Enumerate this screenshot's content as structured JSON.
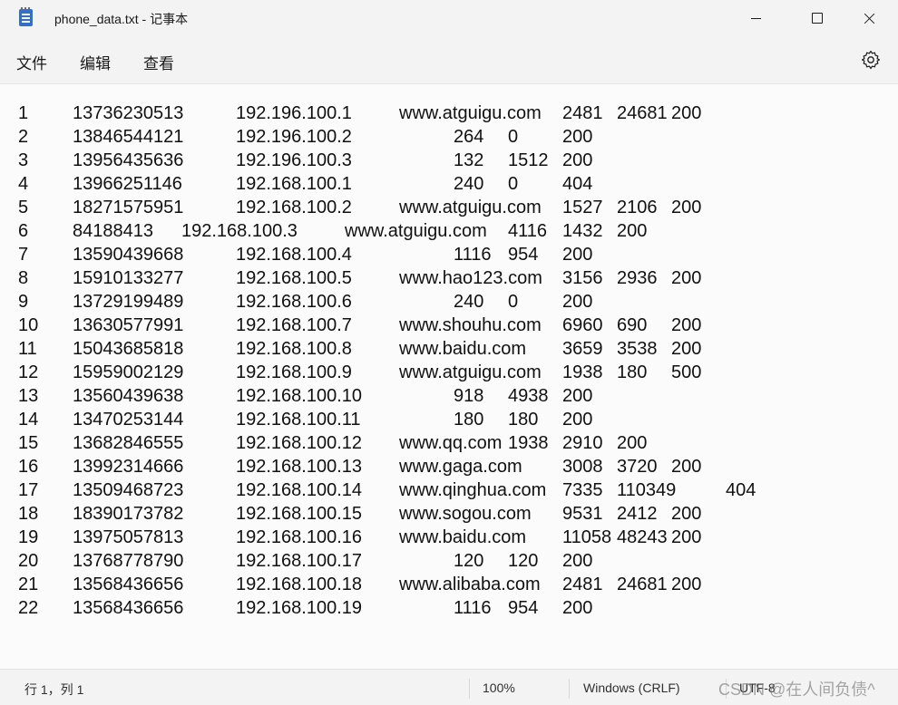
{
  "window": {
    "title": "phone_data.txt - 记事本"
  },
  "menu": {
    "file": "文件",
    "edit": "编辑",
    "view": "查看"
  },
  "icons": {
    "app": "notepad-icon",
    "settings": "gear-icon",
    "minimize": "minimize-icon",
    "maximize": "maximize-icon",
    "close": "close-icon"
  },
  "lines": [
    [
      "1",
      "13736230513",
      "192.196.100.1",
      "www.atguigu.com",
      "2481",
      "24681",
      "200"
    ],
    [
      "2",
      "13846544121",
      "192.196.100.2",
      "",
      "264",
      "0",
      "200"
    ],
    [
      "3",
      "13956435636",
      "192.196.100.3",
      "",
      "132",
      "1512",
      "200"
    ],
    [
      "4",
      "13966251146",
      "192.168.100.1",
      "",
      "240",
      "0",
      "404"
    ],
    [
      "5",
      "18271575951",
      "192.168.100.2",
      "www.atguigu.com",
      "1527",
      "2106",
      "200"
    ],
    [
      "6",
      "84188413",
      "192.168.100.3",
      "www.atguigu.com",
      "4116",
      "1432",
      "200"
    ],
    [
      "7",
      "13590439668",
      "192.168.100.4",
      "",
      "1116",
      "954",
      "200"
    ],
    [
      "8",
      "15910133277",
      "192.168.100.5",
      "www.hao123.com",
      "3156",
      "2936",
      "200"
    ],
    [
      "9",
      "13729199489",
      "192.168.100.6",
      "",
      "240",
      "0",
      "200"
    ],
    [
      "10",
      "13630577991",
      "192.168.100.7",
      "www.shouhu.com",
      "6960",
      "690",
      "200"
    ],
    [
      "11",
      "15043685818",
      "192.168.100.8",
      "www.baidu.com",
      "3659",
      "3538",
      "200"
    ],
    [
      "12",
      "15959002129",
      "192.168.100.9",
      "www.atguigu.com",
      "1938",
      "180",
      "500"
    ],
    [
      "13",
      "13560439638",
      "192.168.100.10",
      "",
      "918",
      "4938",
      "200"
    ],
    [
      "14",
      "13470253144",
      "192.168.100.11",
      "",
      "180",
      "180",
      "200"
    ],
    [
      "15",
      "13682846555",
      "192.168.100.12",
      "www.qq.com",
      "1938",
      "2910",
      "200"
    ],
    [
      "16",
      "13992314666",
      "192.168.100.13",
      "www.gaga.com",
      "3008",
      "3720",
      "200"
    ],
    [
      "17",
      "13509468723",
      "192.168.100.14",
      "www.qinghua.com",
      "7335",
      "110349",
      "404"
    ],
    [
      "18",
      "18390173782",
      "192.168.100.15",
      "www.sogou.com",
      "9531",
      "2412",
      "200"
    ],
    [
      "19",
      "13975057813",
      "192.168.100.16",
      "www.baidu.com",
      "11058",
      "48243",
      "200"
    ],
    [
      "20",
      "13768778790",
      "192.168.100.17",
      "",
      "120",
      "120",
      "200"
    ],
    [
      "21",
      "13568436656",
      "192.168.100.18",
      "www.alibaba.com",
      "2481",
      "24681",
      "200"
    ],
    [
      "22",
      "13568436656",
      "192.168.100.19",
      "",
      "1116",
      "954",
      "200"
    ]
  ],
  "status": {
    "position": "行 1，列 1",
    "zoom": "100%",
    "line_ending": "Windows (CRLF)",
    "encoding": "UTF-8",
    "watermark": "CSDN @在人间负债^"
  }
}
